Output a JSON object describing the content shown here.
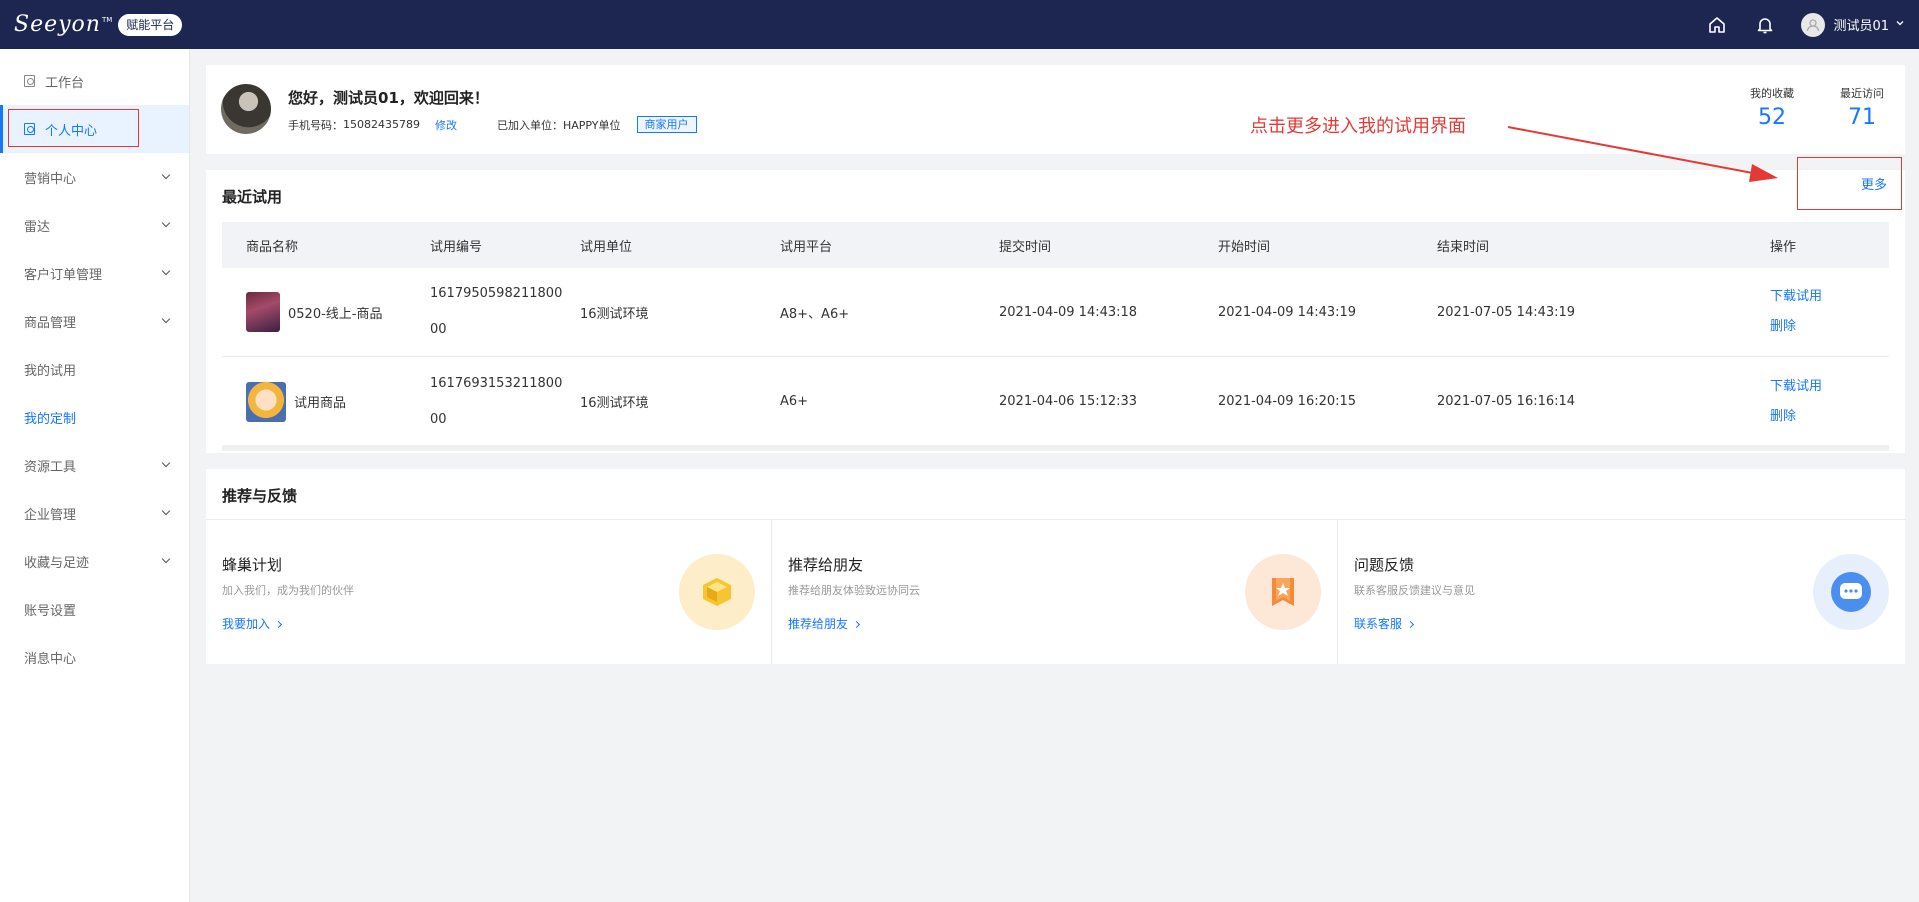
{
  "topbar": {
    "logo_text": "Seeyon",
    "logo_tm": "TM",
    "platform_badge": "赋能平台",
    "username": "测试员01",
    "icons": [
      "home-icon",
      "bell-icon",
      "user-avatar-icon",
      "chevron-down-icon"
    ]
  },
  "sidebar": {
    "items": [
      {
        "label": "工作台"
      },
      {
        "label": "个人中心"
      },
      {
        "label": "营销中心"
      },
      {
        "label": "雷达"
      },
      {
        "label": "客户订单管理"
      },
      {
        "label": "商品管理"
      },
      {
        "label": "我的试用"
      },
      {
        "label": "我的定制"
      },
      {
        "label": "资源工具"
      },
      {
        "label": "企业管理"
      },
      {
        "label": "收藏与足迹"
      },
      {
        "label": "账号设置"
      },
      {
        "label": "消息中心"
      }
    ]
  },
  "profile": {
    "welcome": "您好，测试员01，欢迎回来！",
    "phone_label": "手机号码：",
    "phone": "15082435789",
    "edit_label": "修改",
    "unit_label": "已加入单位：",
    "unit": "HAPPY单位",
    "user_tag": "商家用户",
    "favorites_label": "我的收藏",
    "favorites_count": "52",
    "recent_label": "最近访问",
    "recent_count": "71"
  },
  "annotation": {
    "text": "点击更多进入我的试用界面",
    "color": "#e53935"
  },
  "recent_trials": {
    "title": "最近试用",
    "more_label": "更多",
    "columns": [
      "商品名称",
      "试用编号",
      "试用单位",
      "试用平台",
      "提交时间",
      "开始时间",
      "结束时间",
      "操作"
    ],
    "rows": [
      {
        "product": "0520-线上-商品",
        "serial_line1": "1617950598211800",
        "serial_line2": "00",
        "unit": "16测试环境",
        "platform": "A8+、A6+",
        "submit_time": "2021-04-09 14:43:18",
        "start_time": "2021-04-09 14:43:19",
        "end_time": "2021-07-05 14:43:19",
        "action_download": "下载试用",
        "action_delete": "删除"
      },
      {
        "product": "试用商品",
        "serial_line1": "1617693153211800",
        "serial_line2": "00",
        "unit": "16测试环境",
        "platform": "A6+",
        "submit_time": "2021-04-06 15:12:33",
        "start_time": "2021-04-09 16:20:15",
        "end_time": "2021-07-05 16:16:14",
        "action_download": "下载试用",
        "action_delete": "删除"
      }
    ]
  },
  "feedback": {
    "title": "推荐与反馈",
    "cards": [
      {
        "name": "蜂巢计划",
        "desc": "加入我们，成为我们的伙伴",
        "link": "我要加入",
        "icon": "hive-icon"
      },
      {
        "name": "推荐给朋友",
        "desc": "推荐给朋友体验致远协同云",
        "link": "推荐给朋友",
        "icon": "star-bookmark-icon"
      },
      {
        "name": "问题反馈",
        "desc": "联系客服反馈建议与意见",
        "link": "联系客服",
        "icon": "chat-bubble-icon"
      }
    ]
  },
  "colors": {
    "topbar": "#1c2651",
    "accent": "#1677ff",
    "annotation": "#e53935"
  }
}
